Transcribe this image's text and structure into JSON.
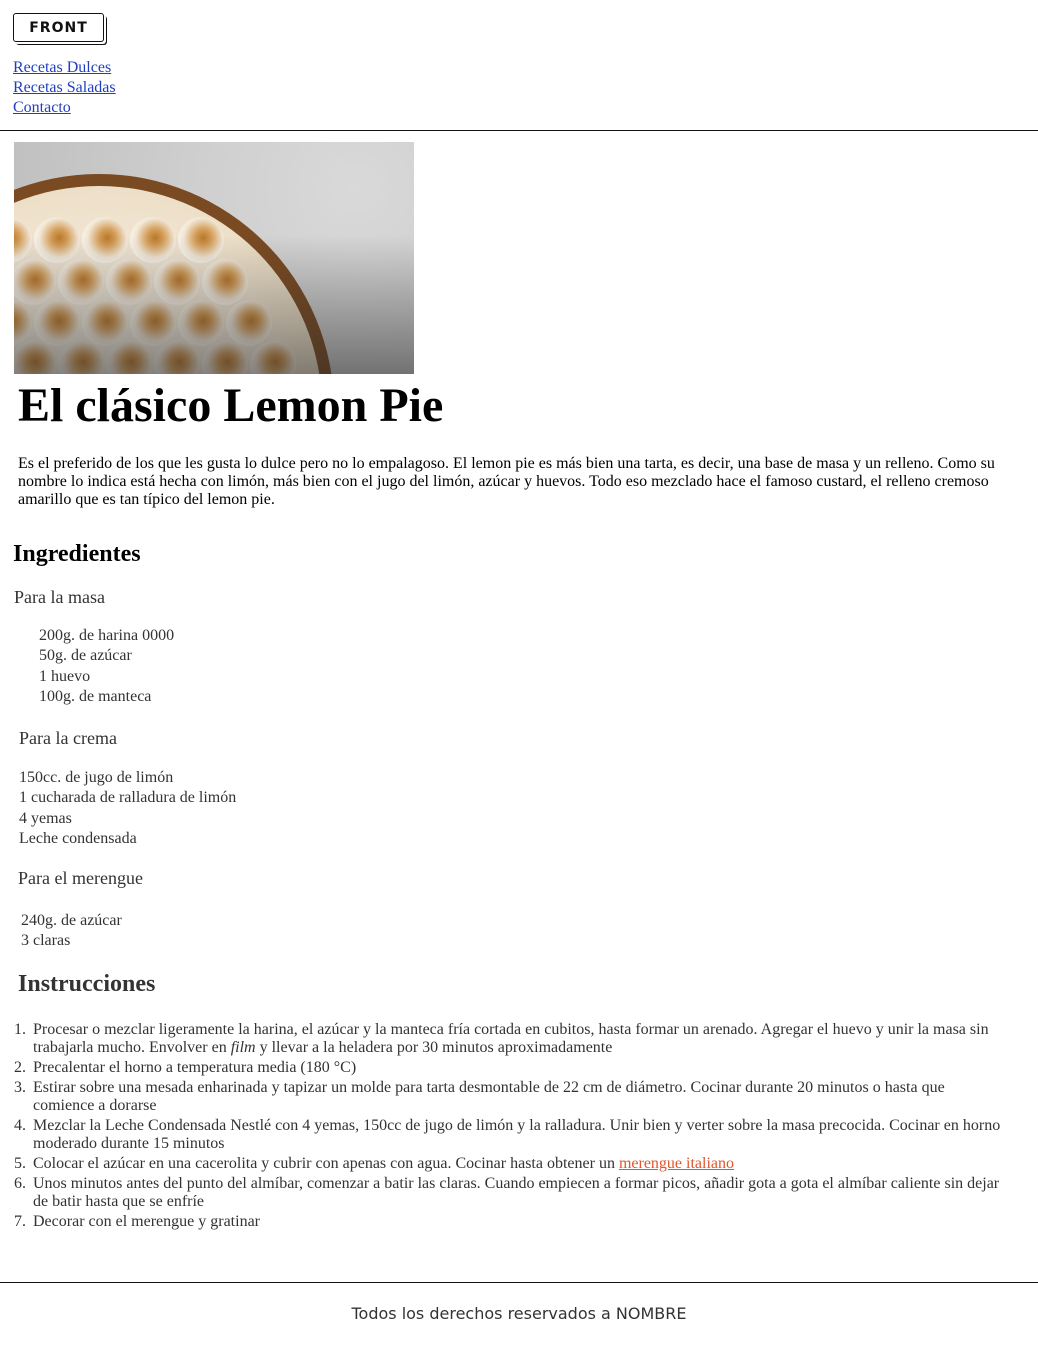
{
  "header": {
    "logo_text": "FRONT",
    "nav": [
      {
        "label": "Recetas Dulces"
      },
      {
        "label": "Recetas Saladas"
      },
      {
        "label": "Contacto"
      }
    ]
  },
  "hero": {
    "alt": "Lemon pie con merengue gratinado"
  },
  "article": {
    "title": "El clásico Lemon Pie",
    "intro": "Es el preferido de los que les gusta lo dulce pero no lo empalagoso. El lemon pie es más bien una tarta, es decir, una base de masa y un relleno. Como su nombre lo indica está hecha con limón, más bien con el jugo del limón, azúcar y huevos. Todo eso mezclado hace el famoso custard, el relleno cremoso amarillo que es tan típico del lemon pie."
  },
  "ingredients": {
    "heading": "Ingredientes",
    "groups": [
      {
        "title": "Para la masa",
        "items": [
          "200g. de harina 0000",
          "50g. de azúcar",
          "1 huevo",
          "100g. de manteca"
        ]
      },
      {
        "title": "Para la crema",
        "items": [
          "150cc. de jugo de limón",
          "1 cucharada de ralladura de limón",
          "4 yemas",
          "Leche condensada"
        ]
      },
      {
        "title": "Para el merengue",
        "items": [
          "240g. de azúcar",
          "3 claras"
        ]
      }
    ]
  },
  "instructions": {
    "heading": "Instrucciones",
    "steps": [
      {
        "num": "1.",
        "before": "Procesar o mezclar ligeramente la harina, el azúcar y la manteca fría cortada en cubitos, hasta formar un arenado. Agregar el huevo y unir la masa sin trabajarla mucho. Envolver en ",
        "em": "film",
        "after": " y llevar a la heladera por 30 minutos aproximadamente"
      },
      {
        "num": "2.",
        "before": "Precalentar el horno a temperatura media (180 °C)"
      },
      {
        "num": "3.",
        "before": "Estirar sobre una mesada enharinada y tapizar un molde para tarta desmontable de 22 cm de diámetro. Cocinar durante 20 minutos o hasta que comience a dorarse"
      },
      {
        "num": "4.",
        "before": "Mezclar la Leche Condensada Nestlé con 4 yemas, 150cc de jugo de limón y la ralladura. Unir bien y verter sobre la masa precocida. Cocinar en horno moderado durante 15 minutos"
      },
      {
        "num": "5.",
        "before": "Colocar el azúcar en una cacerolita y cubrir con apenas con agua. Cocinar hasta obtener un ",
        "link": "merengue italiano"
      },
      {
        "num": "6.",
        "before": "Unos minutos antes del punto del almíbar, comenzar a batir las claras. Cuando empiecen a formar picos, añadir gota a gota el almíbar caliente sin dejar de batir hasta que se enfríe"
      },
      {
        "num": "7.",
        "before": "Decorar con el merengue y gratinar"
      }
    ]
  },
  "footer": {
    "text": "Todos los derechos reservados a NOMBRE"
  }
}
